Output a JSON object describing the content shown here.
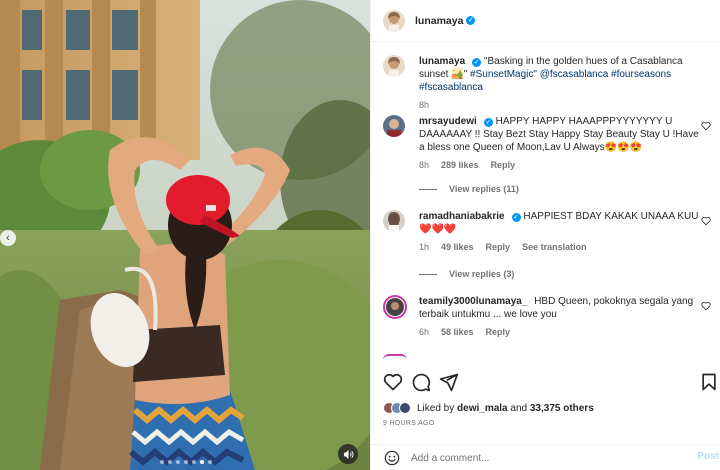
{
  "post": {
    "author": "lunamaya",
    "caption_text": "\"Basking in the golden hues of a Casablanca sunset 🏜️\" ",
    "caption_tags": "#SunsetMagic\" @fscasablanca #fourseasons #fscasablanca",
    "caption_time": "8h"
  },
  "comments": [
    {
      "user": "mrsayudewi",
      "verified": true,
      "text": "HAPPY HAPPY HAAAPPPYYYYYYY U DAAAAAAY !! Stay Bezt Stay Happy Stay Beauty Stay U !Have a bless one Queen of Moon,Lav U Always😍😍😍",
      "time": "8h",
      "likes": "289 likes",
      "reply": "Reply",
      "view_replies": "View replies (11)"
    },
    {
      "user": "ramadhaniabakrie",
      "verified": true,
      "text": "HAPPIEST BDAY KAKAK UNAAA KUU❤️❤️❤️",
      "time": "1h",
      "likes": "49 likes",
      "reply": "Reply",
      "translate": "See translation",
      "view_replies": "View replies (3)"
    },
    {
      "user": "teamily3000lunamaya_",
      "verified": false,
      "text": "HBD Queen, pokoknya segala yang terbaik untukmu ... we love you",
      "time": "6h",
      "likes": "58 likes",
      "reply": "Reply"
    }
  ],
  "likes": {
    "prefix": "Liked by ",
    "user": "dewi_mala",
    "middle": " and ",
    "count": "33,375 others"
  },
  "time_ago": "9 HOURS AGO",
  "comment_box": {
    "placeholder": "Add a comment...",
    "post_label": "Post"
  },
  "icons": {
    "like": "heart-icon",
    "comment": "comment-icon",
    "share": "share-icon",
    "save": "bookmark-icon",
    "emoji": "emoji-icon",
    "sound": "speaker-icon",
    "prev": "chevron-left-icon"
  },
  "colors": {
    "verified": "#0095f6",
    "link": "#00376b",
    "muted": "#737373",
    "post_button": "#b2dffc",
    "cap": "#e21b2c"
  }
}
